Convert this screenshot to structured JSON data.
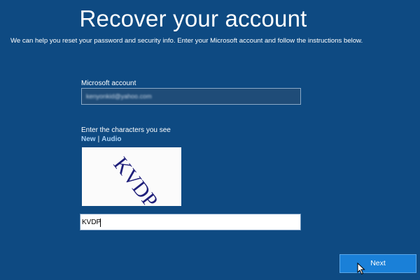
{
  "page": {
    "title": "Recover your account",
    "subtitle": "We can help you reset your password and security info. Enter your Microsoft account and follow the instructions below."
  },
  "account": {
    "label": "Microsoft account",
    "value": "kenyonkid@yahoo.com"
  },
  "captcha": {
    "label": "Enter the characters you see",
    "new_link": "New",
    "separator": "|",
    "audio_link": "Audio",
    "image_text": "KVDP",
    "answer_value": "KVDP"
  },
  "actions": {
    "next_label": "Next"
  },
  "colors": {
    "background": "#0e4a82",
    "link": "#a9d1f5",
    "button": "#1a80d8",
    "captcha_ink": "#1f1f7a"
  }
}
